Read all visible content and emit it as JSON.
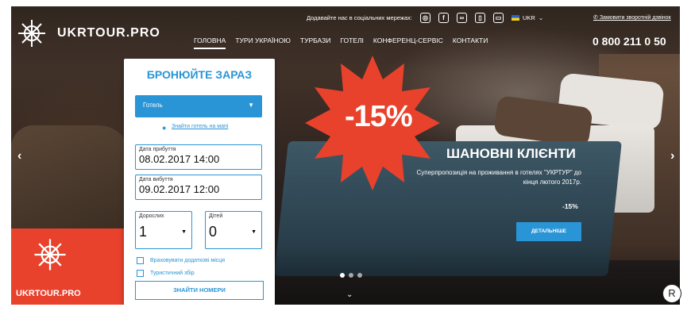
{
  "header": {
    "brand": "UKRTOUR.PRO",
    "social_label": "Додавайте нас в соціальних мережах:",
    "social_icons": [
      "instagram-icon",
      "facebook-icon",
      "tripadvisor-icon",
      "phone-app-icon",
      "gallery-icon"
    ],
    "language": "UKR",
    "callback": "Замовити зворотній дзвінок",
    "phone": "0 800 211 0 50",
    "nav": [
      {
        "label": "ГОЛОВНА",
        "active": true
      },
      {
        "label": "ТУРИ УКРАЇНОЮ",
        "active": false
      },
      {
        "label": "ТУРБАЗИ",
        "active": false
      },
      {
        "label": "ГОТЕЛІ",
        "active": false
      },
      {
        "label": "КОНФЕРЕНЦ-СЕРВІС",
        "active": false
      },
      {
        "label": "КОНТАКТИ",
        "active": false
      }
    ]
  },
  "booking": {
    "title": "БРОНЮЙТЕ ЗАРАЗ",
    "hotel_select": "Готель",
    "map_link": "Знайти готель на мапі",
    "arrival_label": "Дата прибуття",
    "arrival_value": "08.02.2017 14:00",
    "departure_label": "Дата вибуття",
    "departure_value": "09.02.2017 12:00",
    "adults_label": "Дорослих",
    "adults_value": "1",
    "children_label": "Дітей",
    "children_value": "0",
    "extra_places": "Враховувати додаткові місця",
    "tourist_fee": "Туристичний збір",
    "find_button": "ЗНАЙТИ НОМЕРИ"
  },
  "promo": {
    "badge": "-15%",
    "headline": "ШАНОВНІ КЛІЄНТИ",
    "subline": "Суперпропозиція на проживання в готелях \"УКРТУР\" до кінця лютого 2017р.",
    "discount": "-15%",
    "details_button": "ДЕТАЛЬНІШЕ"
  },
  "corner": {
    "brand": "UKRTOUR.PRO"
  },
  "slider": {
    "active_dot": 1,
    "dot_count": 3
  },
  "colors": {
    "accent": "#2a95d6",
    "red": "#e8412c"
  },
  "registered_mark": "R"
}
